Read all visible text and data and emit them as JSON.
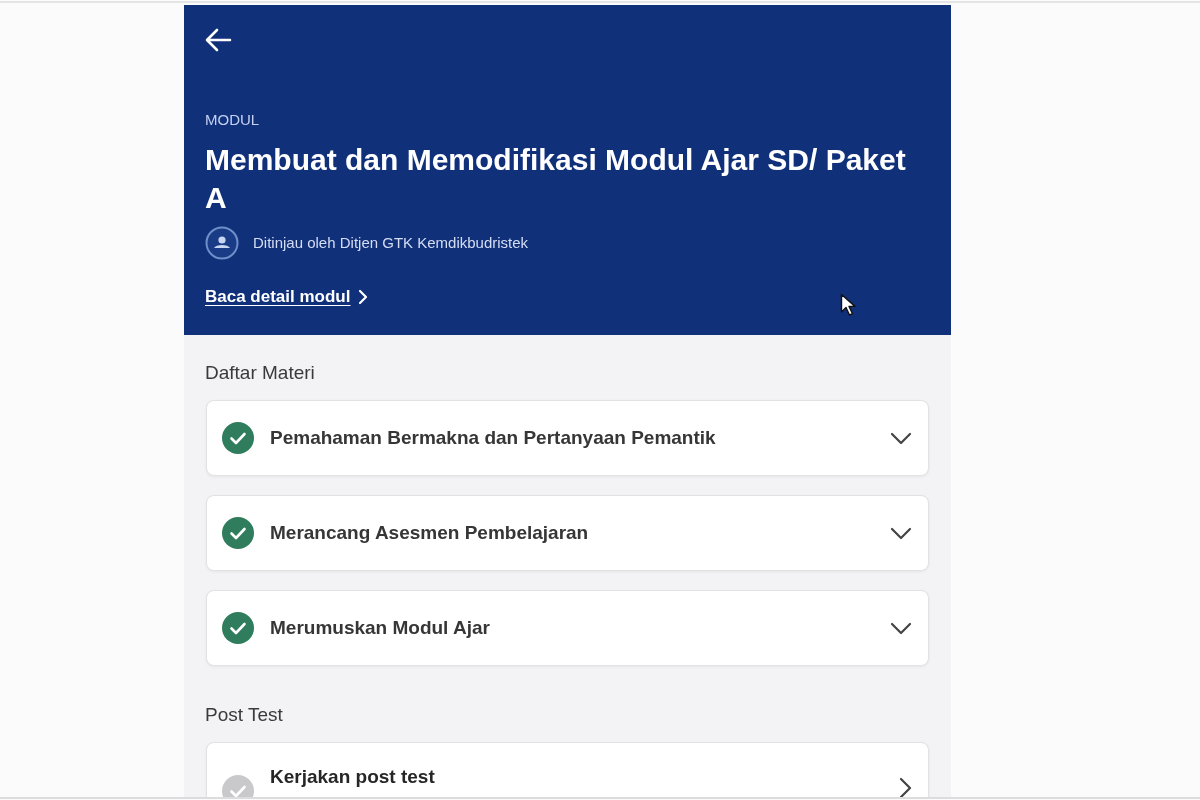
{
  "header": {
    "eyebrow": "MODUL",
    "title": "Membuat dan Memodifikasi Modul Ajar SD/ Paket A",
    "reviewer": "Ditinjau oleh Ditjen GTK Kemdikbudristek",
    "detail_link": "Baca detail modul"
  },
  "sections": [
    {
      "title": "Daftar Materi",
      "items": [
        {
          "kind": "accordion",
          "label": "Pemahaman Bermakna dan Pertanyaan Pemantik",
          "completed": true,
          "expanded": false
        },
        {
          "kind": "accordion",
          "label": "Merancang Asesmen Pembelajaran",
          "completed": true,
          "expanded": false
        },
        {
          "kind": "accordion",
          "label": "Merumuskan Modul Ajar",
          "completed": true,
          "expanded": false
        }
      ]
    },
    {
      "title": "Post Test",
      "items": [
        {
          "kind": "link",
          "label": "Kerjakan post test",
          "completed": false
        }
      ]
    }
  ]
}
